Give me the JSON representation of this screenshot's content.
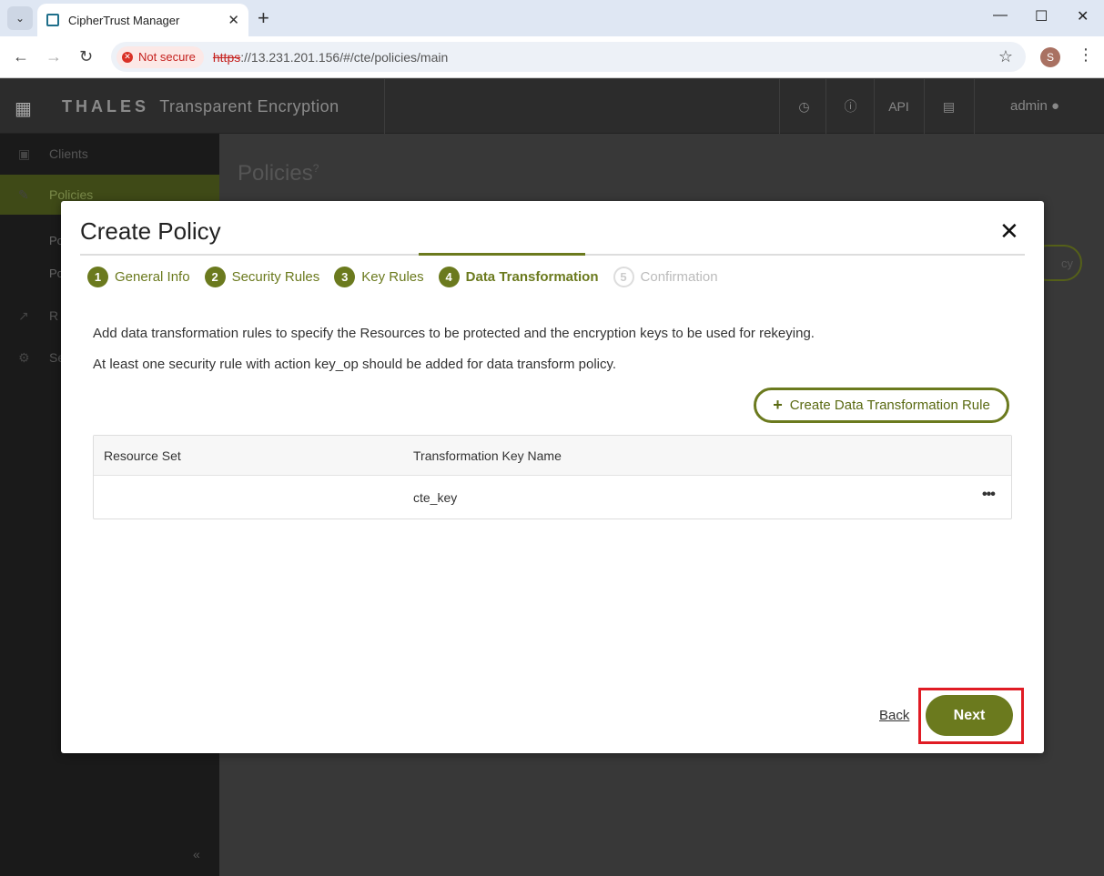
{
  "browser": {
    "tab_title": "CipherTrust Manager",
    "security_label": "Not secure",
    "url_scheme": "https",
    "url_rest": "://13.231.201.156/#/cte/policies/main",
    "profile_initial": "S"
  },
  "app": {
    "brand_thales": "THALES",
    "brand_product": "Transparent Encryption",
    "header_api": "API",
    "header_user": "admin",
    "sidebar": {
      "clients": "Clients",
      "policies": "Policies",
      "sub1": "Po",
      "sub2": "Po",
      "item3": "R",
      "item4": "Se"
    },
    "page_title": "Policies",
    "ghost_button": "cy"
  },
  "modal": {
    "title": "Create Policy",
    "steps": [
      {
        "num": "1",
        "label": "General Info"
      },
      {
        "num": "2",
        "label": "Security Rules"
      },
      {
        "num": "3",
        "label": "Key Rules"
      },
      {
        "num": "4",
        "label": "Data Transformation"
      },
      {
        "num": "5",
        "label": "Confirmation"
      }
    ],
    "desc1": "Add data transformation rules to specify the Resources to be protected and the encryption keys to be used for rekeying.",
    "desc2": "At least one security rule with action key_op should be added for data transform policy.",
    "create_rule_label": "Create Data Transformation Rule",
    "table": {
      "headers": [
        "Resource Set",
        "Transformation Key Name"
      ],
      "rows": [
        {
          "resource_set": "",
          "key_name": "cte_key"
        }
      ]
    },
    "back_label": "Back",
    "next_label": "Next"
  },
  "colors": {
    "accent": "#6b7a1e",
    "highlight": "#e01b24"
  }
}
